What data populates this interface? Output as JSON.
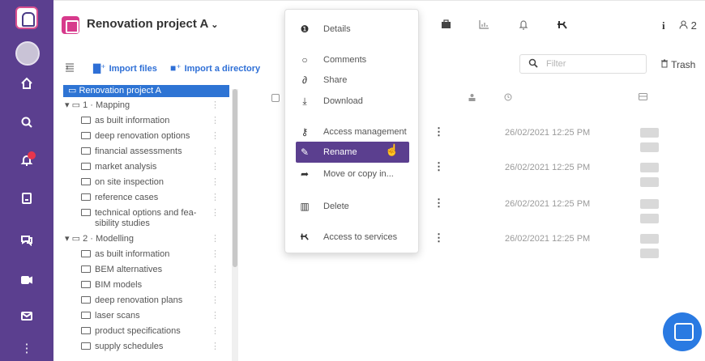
{
  "app": {
    "project_title": "Renovation project A",
    "project_caret": "⌄",
    "user_count": "2"
  },
  "toolbar": {
    "import_files": "Import files",
    "import_directory": "Import a directory",
    "filter_placeholder": "Filter",
    "trash_label": "Trash"
  },
  "tree": {
    "root": "Renovation project A",
    "groups": [
      {
        "label": "1 · Mapping",
        "children": [
          "as built information",
          "deep renovation options",
          "financial assessments",
          "market analysis",
          "on site inspection",
          "reference cases",
          "technical options and fea-",
          "sibility studies"
        ]
      },
      {
        "label": "2 · Modelling",
        "children": [
          "as built information",
          "BEM alternatives",
          "BIM models",
          "deep renovation plans",
          "laser scans",
          "product specifications",
          "supply schedules"
        ]
      }
    ]
  },
  "context_menu": {
    "items": [
      {
        "icon": "info-icon",
        "label": "Details"
      },
      {
        "icon": "comment-icon",
        "label": "Comments"
      },
      {
        "icon": "share-icon",
        "label": "Share"
      },
      {
        "icon": "download-icon",
        "label": "Download"
      },
      {
        "icon": "key-icon",
        "label": "Access management"
      },
      {
        "icon": "pencil-icon",
        "label": "Rename",
        "active": true
      },
      {
        "icon": "forward-arrow-icon",
        "label": "Move or copy in..."
      },
      {
        "icon": "trash-icon",
        "label": "Delete"
      },
      {
        "icon": "services-icon",
        "label": "Access to services"
      }
    ]
  },
  "files": {
    "rows": [
      {
        "date": "26/02/2021 12:25 PM"
      },
      {
        "date": "26/02/2021 12:25 PM"
      },
      {
        "date": "26/02/2021 12:25 PM"
      },
      {
        "date": "26/02/2021 12:25 PM"
      }
    ]
  },
  "colors": {
    "nav_purple": "#5b3f8f",
    "accent_blue": "#2e74d4",
    "brand_pink": "#d73a8c",
    "notification_red": "#e8354c"
  }
}
